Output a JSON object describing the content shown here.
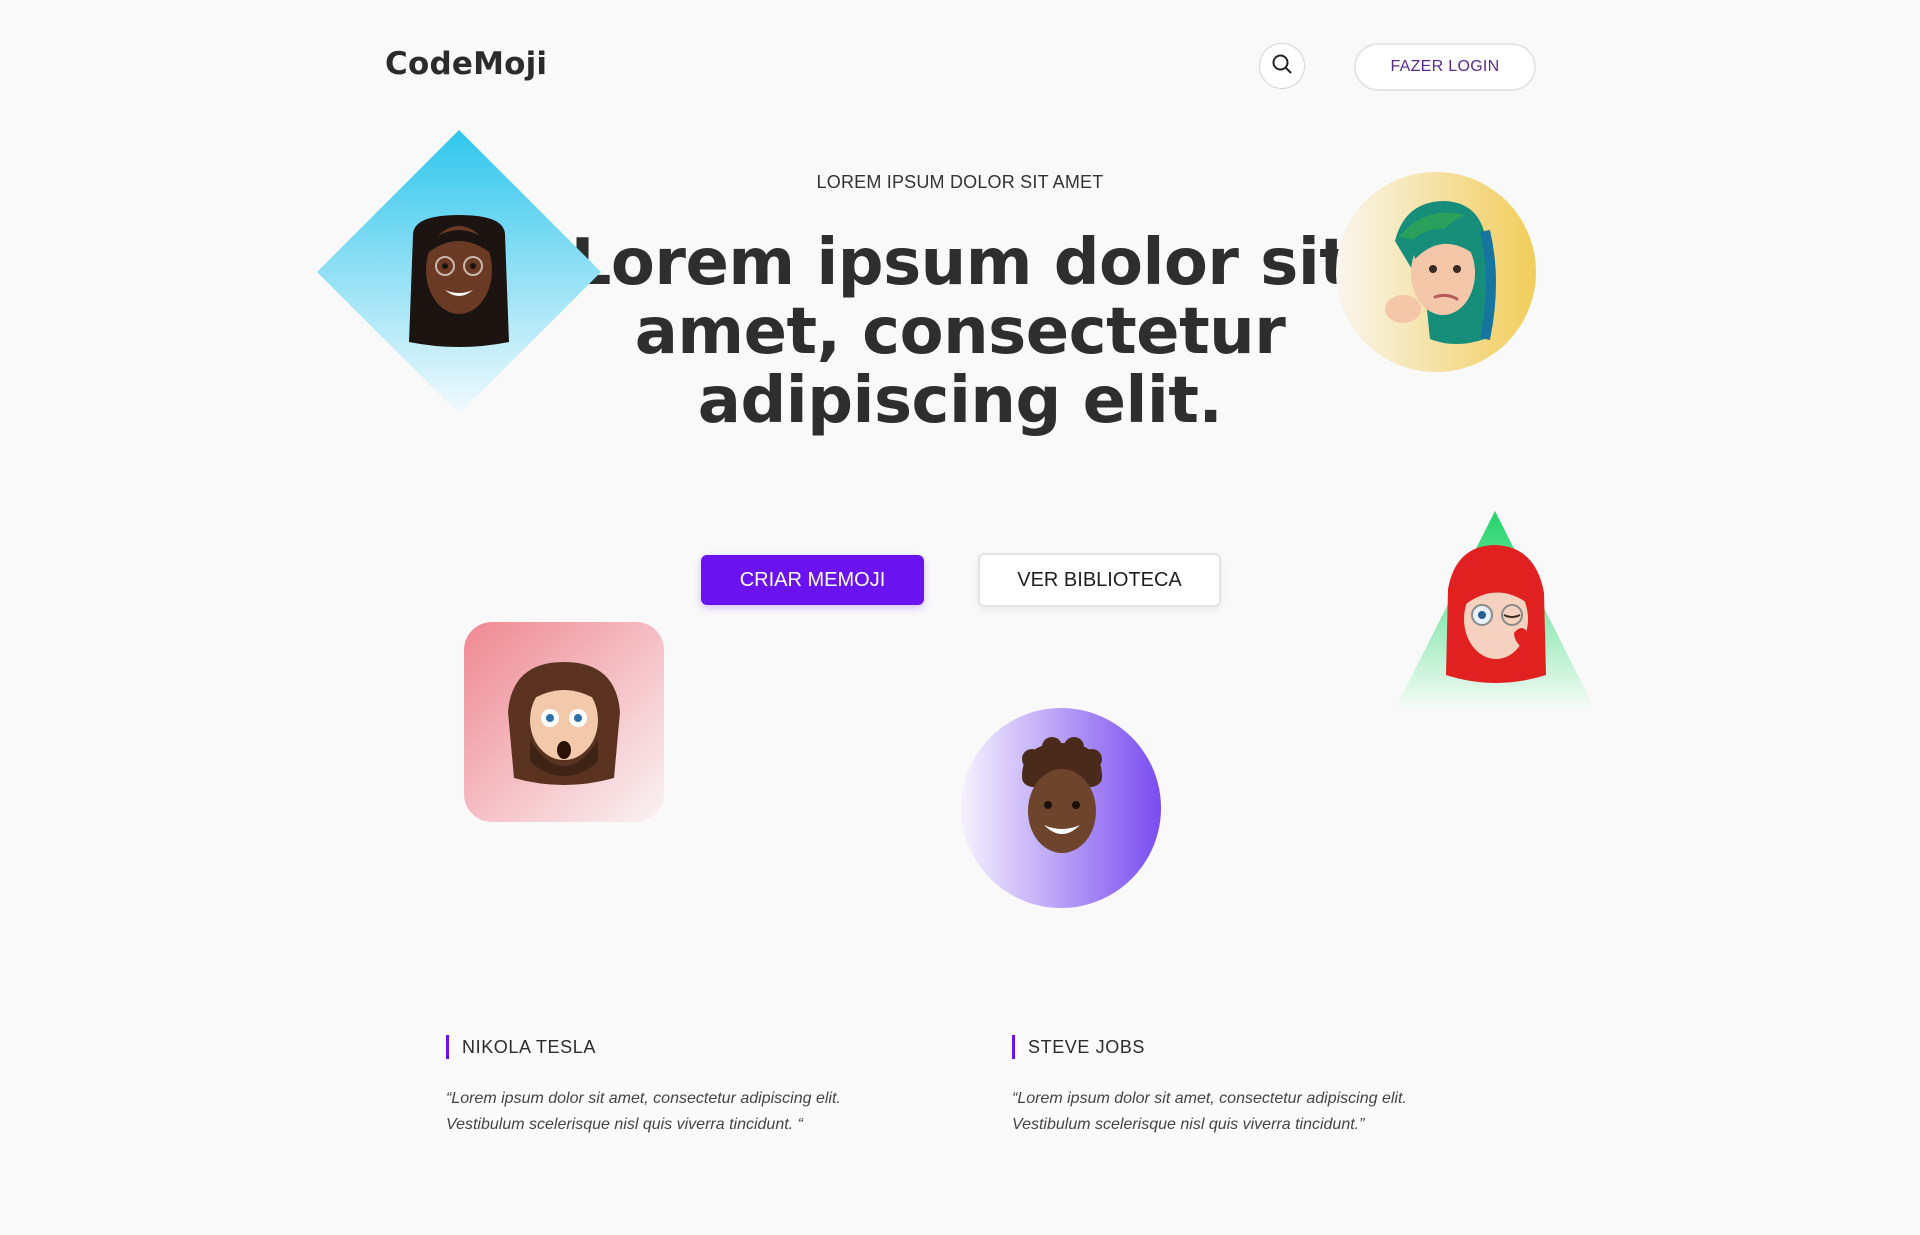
{
  "header": {
    "logo": "CodeMoji",
    "login_label": "FAZER LOGIN"
  },
  "hero": {
    "eyebrow": "LOREM IPSUM DOLOR SIT AMET",
    "headline": "Lorem ipsum dolor sit amet, consectetur adipiscing elit.",
    "primary_button": "CRIAR MEMOJI",
    "secondary_button": "VER BIBLIOTECA"
  },
  "testimonials": [
    {
      "name": "NIKOLA TESLA",
      "quote": "“Lorem ipsum dolor sit amet, consectetur adipiscing elit. Vestibulum scelerisque nisl quis viverra tincidunt. “"
    },
    {
      "name": "STEVE JOBS",
      "quote": "“Lorem ipsum dolor sit amet, consectetur adipiscing elit. Vestibulum scelerisque nisl quis viverra tincidunt.”"
    }
  ],
  "colors": {
    "accent": "#6a12f0",
    "background": "#f9f9f9",
    "diamond_top": "#2fc6ec",
    "circle_gold": "#f1cd5a",
    "triangle_green": "#22d46a",
    "square_pink": "#ef8892",
    "circle_purple": "#7a4cf0"
  }
}
